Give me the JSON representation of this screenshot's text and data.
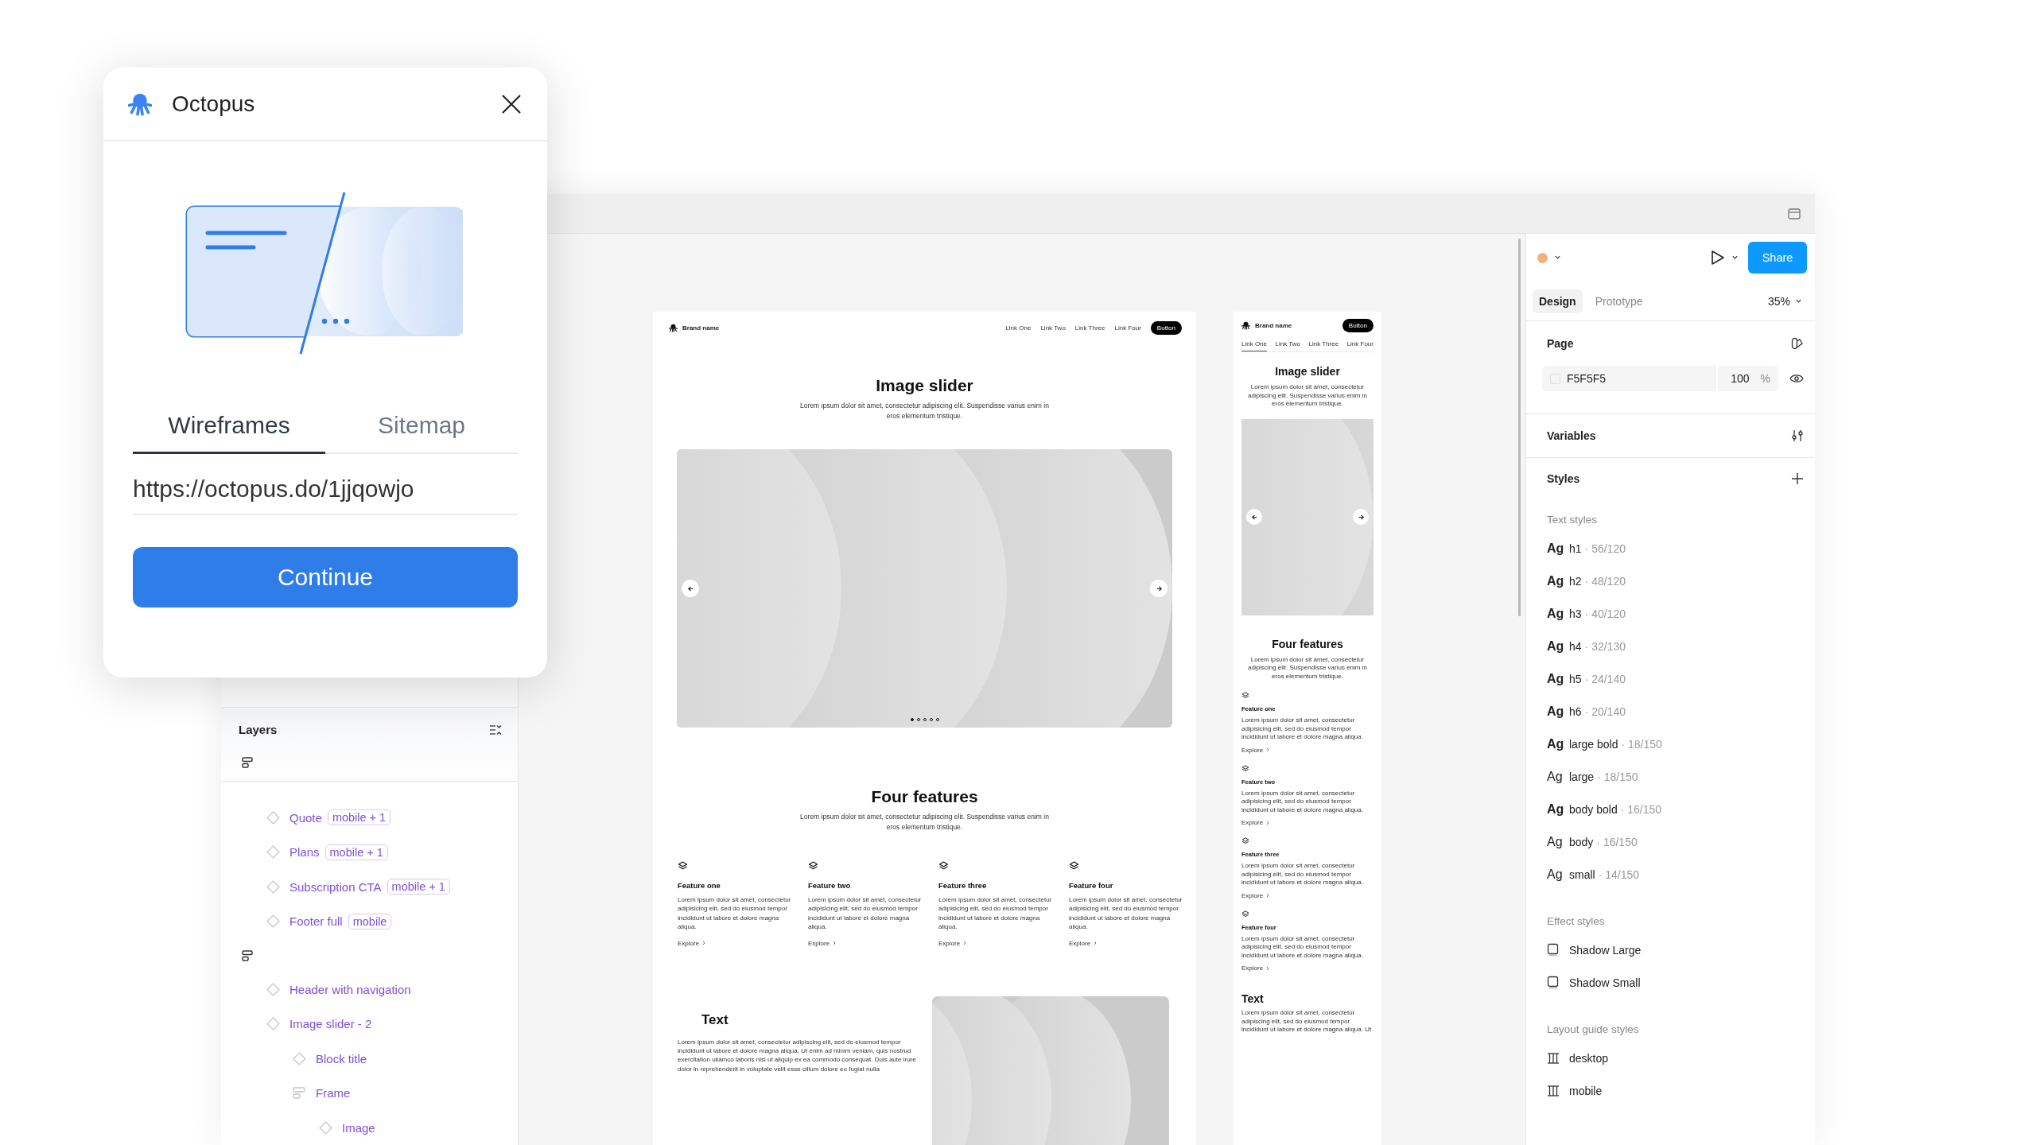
{
  "dialog": {
    "title": "Octopus",
    "tabs": [
      {
        "label": "Wireframes",
        "selected": true
      },
      {
        "label": "Sitemap",
        "selected": false
      }
    ],
    "url": "https://octopus.do/1jjqowjo",
    "button": "Continue"
  },
  "layers": {
    "title": "Layers",
    "groups": [
      {
        "items": [
          {
            "name": "Quote",
            "tag": "mobile + 1",
            "kind": "component"
          },
          {
            "name": "Plans",
            "tag": "mobile + 1",
            "kind": "component"
          },
          {
            "name": "Subscription CTA",
            "tag": "mobile + 1",
            "kind": "component"
          },
          {
            "name": "Footer full",
            "tag": "mobile",
            "kind": "component"
          }
        ]
      },
      {
        "items": [
          {
            "name": "Header with navigation",
            "kind": "component"
          },
          {
            "name": "Image slider - 2",
            "kind": "component",
            "children": [
              {
                "name": "Block title",
                "kind": "component"
              },
              {
                "name": "Frame",
                "kind": "frame",
                "children": [
                  {
                    "name": "Image",
                    "kind": "component"
                  }
                ]
              }
            ]
          }
        ]
      }
    ]
  },
  "canvas": {
    "frames": [
      {
        "kind": "desktop",
        "brand": "Brand name",
        "nav": [
          {
            "label": "Link One"
          },
          {
            "label": "Link Two"
          },
          {
            "label": "Link Three"
          },
          {
            "label": "Link Four"
          }
        ],
        "button": "Button",
        "slider": {
          "title": "Image slider",
          "text": "Lorem ipsum dolor sit amet, consectetur adipiscing elit. Suspendisse varius enim in eros elementum tristique.",
          "dots": [
            {
              "selected": true
            },
            {
              "selected": false
            },
            {
              "selected": false
            },
            {
              "selected": false
            },
            {
              "selected": false
            }
          ]
        },
        "features": {
          "title": "Four features",
          "text": "Lorem ipsum dolor sit amet, consectetur adipiscing elit. Suspendisse varius enim in eros elementum tristique.",
          "items": [
            {
              "title": "Feature one",
              "text": "Lorem ipsum dolor sit amet, consectetur adipisicing elit, sed do eiusmod tempor incididunt ut labore et dolore magna aliqua.",
              "link": "Explore"
            },
            {
              "title": "Feature two",
              "text": "Lorem ipsum dolor sit amet, consectetur adipisicing elit, sed do eiusmod tempor incididunt ut labore et dolore magna aliqua.",
              "link": "Explore"
            },
            {
              "title": "Feature three",
              "text": "Lorem ipsum dolor sit amet, consectetur adipisicing elit, sed do eiusmod tempor incididunt ut labore et dolore magna aliqua.",
              "link": "Explore"
            },
            {
              "title": "Feature four",
              "text": "Lorem ipsum dolor sit amet, consectetur adipisicing elit, sed do eiusmod tempor incididunt ut labore et dolore magna aliqua.",
              "link": "Explore"
            }
          ]
        },
        "text_section": {
          "title": "Text",
          "body": "Lorem ipsum dolor sit amet, consectetur adipiscing elit, sed do eiusmod tempor incididunt ut labore et dolore magna aliqua. Ut enim ad minim veniam, quis nostrud exercitation ullamco laboris nisi ut aliquip ex ea commodo consequat. Duis aute irure dolor in reprehenderit in voluptate velit esse cillum dolore eu fugiat nulla"
        }
      },
      {
        "kind": "mobile",
        "brand": "Brand name",
        "nav": [
          {
            "label": "Link One",
            "selected": true
          },
          {
            "label": "Link Two",
            "selected": false
          },
          {
            "label": "Link Three",
            "selected": false
          },
          {
            "label": "Link Four",
            "selected": false
          }
        ],
        "button": "Button",
        "slider": {
          "title": "Image slider",
          "text": "Lorem ipsum dolor sit amet, consectetur adipiscing elit. Suspendisse varius enim in eros elementum tristique."
        },
        "features": {
          "title": "Four features",
          "text": "Lorem ipsum dolor sit amet, consectetur adipiscing elit. Suspendisse varius enim in eros elementum tristique.",
          "items": [
            {
              "title": "Feature one",
              "text": "Lorem ipsum dolor sit amet, consectetur adipisicing elit, sed do eiusmod tempor incididunt ut labore et dolore magna aliqua.",
              "link": "Explore"
            },
            {
              "title": "Feature two",
              "text": "Lorem ipsum dolor sit amet, consectetur adipisicing elit, sed do eiusmod tempor incididunt ut labore et dolore magna aliqua.",
              "link": "Explore"
            },
            {
              "title": "Feature three",
              "text": "Lorem ipsum dolor sit amet, consectetur adipisicing elit, sed do eiusmod tempor incididunt ut labore et dolore magna aliqua.",
              "link": "Explore"
            },
            {
              "title": "Feature four",
              "text": "Lorem ipsum dolor sit amet, consectetur adipisicing elit, sed do eiusmod tempor incididunt ut labore et dolore magna aliqua.",
              "link": "Explore"
            }
          ]
        },
        "text_section": {
          "title": "Text",
          "body": "Lorem ipsum dolor sit amet, consectetur adipiscing elit, sed do eiusmod tempor incididunt ut labore et dolore magna aliqua. Ut"
        }
      }
    ]
  },
  "inspector": {
    "share": "Share",
    "tabs": [
      {
        "label": "Design",
        "selected": true
      },
      {
        "label": "Prototype",
        "selected": false
      }
    ],
    "zoom": "35%",
    "page": {
      "title": "Page",
      "fill": "F5F5F5",
      "opacity": "100",
      "unit": "%"
    },
    "variables": "Variables",
    "styles": "Styles",
    "text_styles": {
      "title": "Text styles",
      "items": [
        {
          "sample": "Ag",
          "name": "h1",
          "spec": "· 56/120",
          "bold": true
        },
        {
          "sample": "Ag",
          "name": "h2",
          "spec": "· 48/120",
          "bold": true
        },
        {
          "sample": "Ag",
          "name": "h3",
          "spec": "· 40/120",
          "bold": true
        },
        {
          "sample": "Ag",
          "name": "h4",
          "spec": "· 32/130",
          "bold": true
        },
        {
          "sample": "Ag",
          "name": "h5",
          "spec": "· 24/140",
          "bold": true
        },
        {
          "sample": "Ag",
          "name": "h6",
          "spec": "· 20/140",
          "bold": true
        },
        {
          "sample": "Ag",
          "name": "large bold",
          "spec": "· 18/150",
          "bold": true
        },
        {
          "sample": "Ag",
          "name": "large",
          "spec": "· 18/150",
          "bold": false
        },
        {
          "sample": "Ag",
          "name": "body bold",
          "spec": "· 16/150",
          "bold": true
        },
        {
          "sample": "Ag",
          "name": "body",
          "spec": "· 16/150",
          "bold": false
        },
        {
          "sample": "Ag",
          "name": "small",
          "spec": "· 14/150",
          "bold": false
        }
      ]
    },
    "effect_styles": {
      "title": "Effect styles",
      "items": [
        "Shadow Large",
        "Shadow Small"
      ]
    },
    "layout_guides": {
      "title": "Layout guide styles",
      "items": [
        "desktop",
        "mobile"
      ]
    }
  }
}
